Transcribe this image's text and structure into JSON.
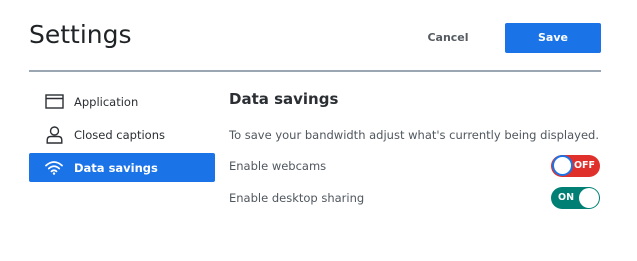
{
  "header": {
    "title": "Settings",
    "cancel_label": "Cancel",
    "save_label": "Save"
  },
  "sidebar": {
    "items": [
      {
        "label": "Application",
        "icon": "window-icon",
        "active": false
      },
      {
        "label": "Closed captions",
        "icon": "person-icon",
        "active": false
      },
      {
        "label": "Data savings",
        "icon": "wifi-icon",
        "active": true
      }
    ]
  },
  "main": {
    "title": "Data savings",
    "description": "To save your bandwidth adjust what's currently being displayed.",
    "settings": [
      {
        "label": "Enable webcams",
        "state": "off",
        "toggle_text": "OFF"
      },
      {
        "label": "Enable desktop sharing",
        "state": "on",
        "toggle_text": "ON"
      }
    ]
  },
  "colors": {
    "accent": "#1b73e8",
    "toggle_off": "#e0302c",
    "toggle_on": "#008075",
    "divider": "#9aa6b1"
  }
}
